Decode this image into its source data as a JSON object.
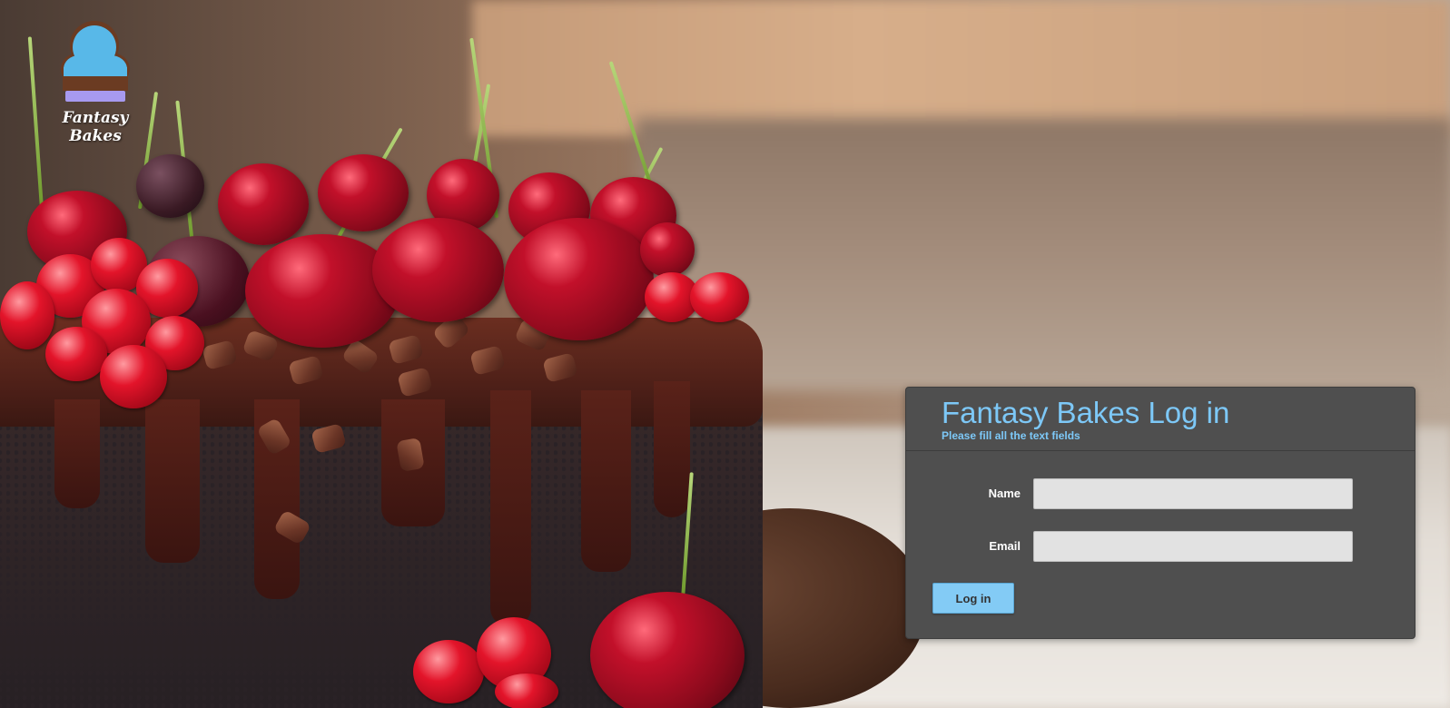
{
  "brand": {
    "logo_icon": "cupcake-icon",
    "logo_text": "Fantasy Bakes"
  },
  "login_panel": {
    "title": "Fantasy Bakes Log in",
    "subtitle": "Please fill all the text fields",
    "fields": [
      {
        "label": "Name",
        "value": "",
        "placeholder": ""
      },
      {
        "label": "Email",
        "value": "",
        "placeholder": ""
      }
    ],
    "submit_label": "Log in"
  },
  "colors": {
    "accent": "#7dc8f7",
    "panel_bg": "#4f4f4f",
    "button_bg": "#83cbf5",
    "input_bg": "#e2e2e2"
  },
  "background_image": "chocolate-cherry-cake-photo"
}
